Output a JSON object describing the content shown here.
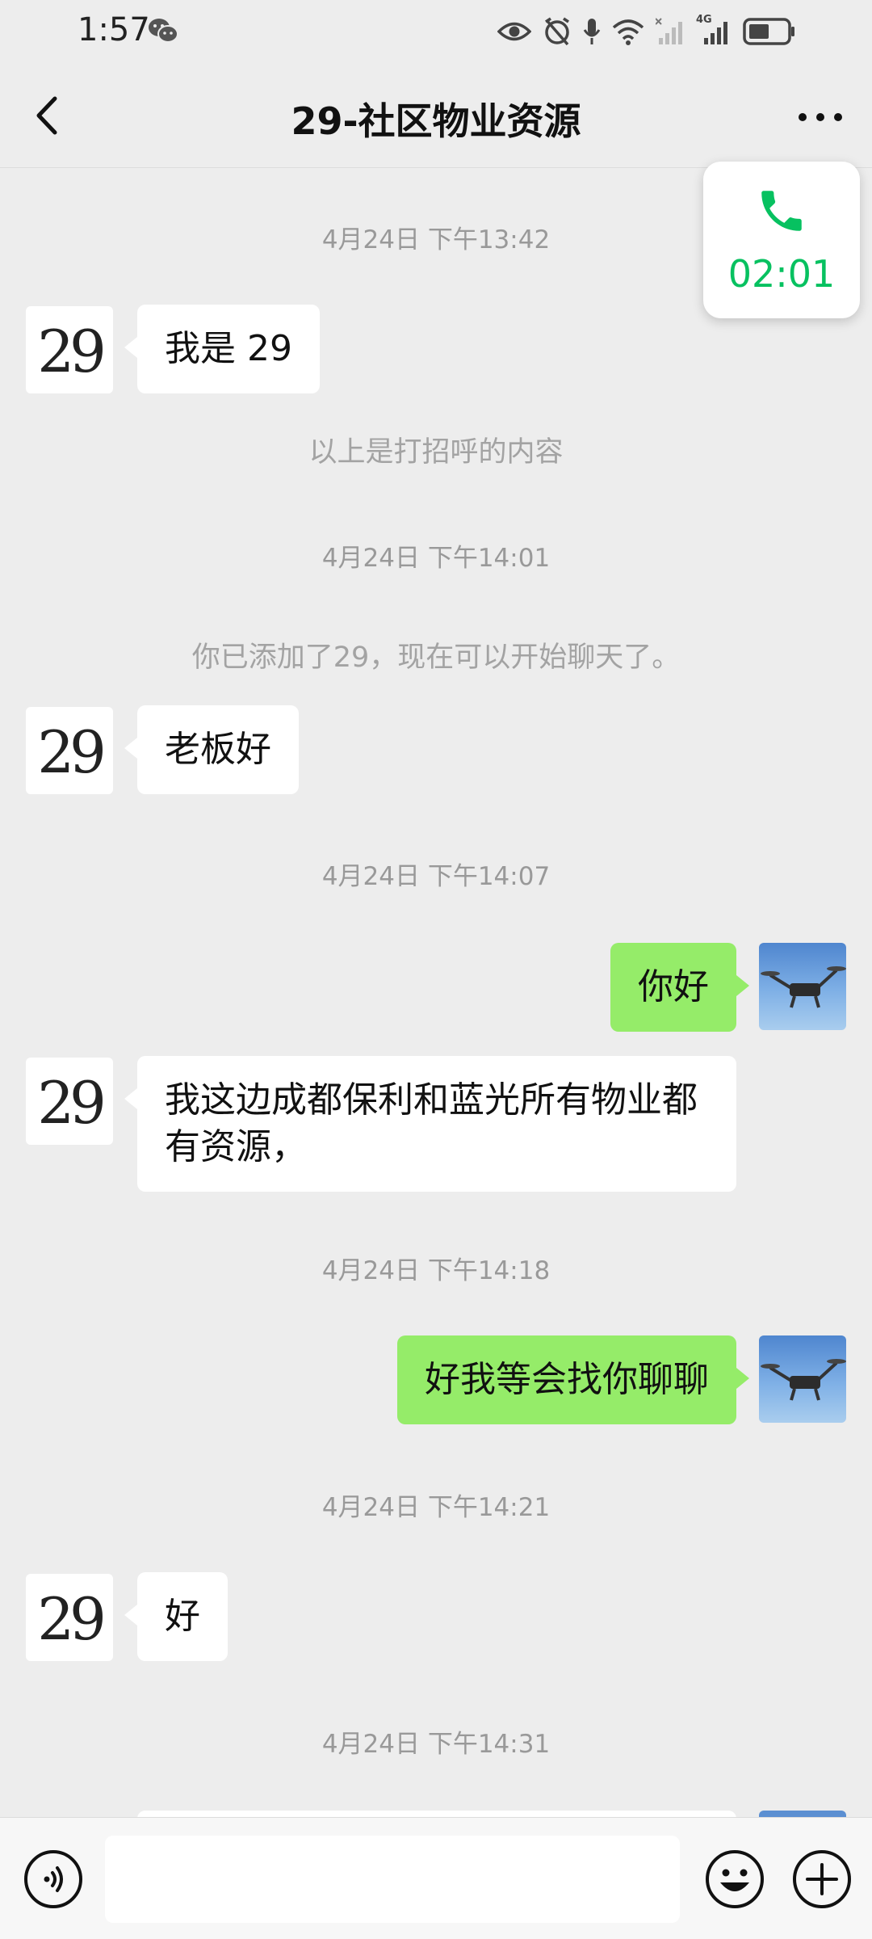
{
  "status_bar": {
    "time": "1:57",
    "network_label": "4G"
  },
  "nav": {
    "title": "29-社区物业资源"
  },
  "call_card": {
    "timer": "02:01",
    "accent": "#07c160"
  },
  "contact": {
    "avatar_text": "29"
  },
  "messages": {
    "ts1": "4月24日 下午13:42",
    "m1": "我是 29",
    "sys1": "以上是打招呼的内容",
    "ts2": "4月24日 下午14:01",
    "sys2": "你已添加了29，现在可以开始聊天了。",
    "m2": "老板好",
    "ts3": "4月24日 下午14:07",
    "m3": "你好",
    "m4": "我这边成都保利和蓝光所有物业都有资源，",
    "ts4": "4月24日 下午14:18",
    "m5": "好我等会找你聊聊",
    "ts5": "4月24日 下午14:21",
    "m6": "好",
    "ts6": "4月24日 下午14:31"
  },
  "colors": {
    "sent_bubble": "#95ec69",
    "received_bubble": "#ffffff",
    "background": "#ededed"
  }
}
